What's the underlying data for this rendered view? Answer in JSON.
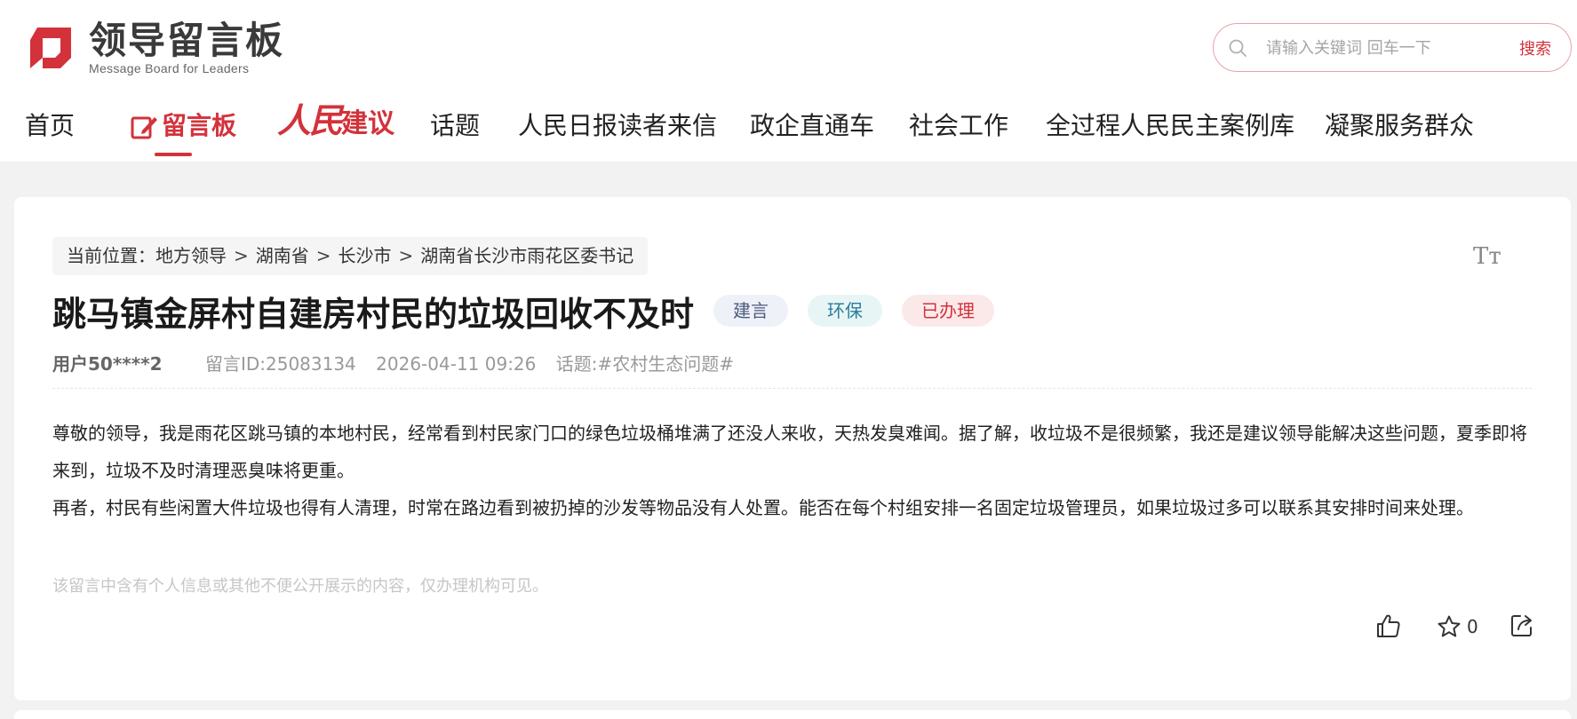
{
  "header": {
    "logo": {
      "title": "领导留言板",
      "subtitle": "Message Board for Leaders",
      "brand_color": "#d3323b"
    },
    "search": {
      "placeholder": "请输入关键词 回车一下",
      "button_label": "搜索",
      "icon": "search-icon"
    },
    "nav": {
      "home": "首页",
      "message_board": "留言板",
      "renmin": "人民",
      "jianyi": "建议",
      "topics": "话题",
      "readers_letters": "人民日报读者来信",
      "gov_enterprise": "政企直通车",
      "social_work": "社会工作",
      "democracy_cases": "全过程人民民主案例库",
      "serve_people": "凝聚服务群众",
      "active_item": "留言板"
    }
  },
  "breadcrumb": {
    "prefix": "当前位置：",
    "items": [
      "地方领导",
      "湖南省",
      "长沙市",
      "湖南省长沙市雨花区委书记"
    ],
    "separator": ">"
  },
  "font_size_toggle": "Tт",
  "post": {
    "title": "跳马镇金屏村自建房村民的垃圾回收不及时",
    "tags": {
      "category": "建言",
      "field": "环保",
      "status": "已办理"
    },
    "user": "用户50****2",
    "message_id": "留言ID:25083134",
    "datetime": "2026-04-11 09:26",
    "topic_label": "话题:",
    "topic": "#农村生态问题#",
    "paragraphs": [
      "尊敬的领导，我是雨花区跳马镇的本地村民，经常看到村民家门口的绿色垃圾桶堆满了还没人来收，天热发臭难闻。据了解，收垃圾不是很频繁，我还是建议领导能解决这些问题，夏季即将来到，垃圾不及时清理恶臭味将更重。",
      "再者，村民有些闲置大件垃圾也得有人清理，时常在路边看到被扔掉的沙发等物品没有人处置。能否在每个村组安排一名固定垃圾管理员，如果垃圾过多可以联系其安排时间来处理。"
    ],
    "privacy_notice": "该留言中含有个人信息或其他不便公开展示的内容，仅办理机构可见。",
    "actions": {
      "like_icon": "thumbs-up-icon",
      "favorite_icon": "star-icon",
      "favorite_count": "0",
      "share_icon": "share-icon"
    }
  },
  "colors": {
    "accent": "#d3323b",
    "page_bg": "#f2f2f3",
    "card_bg": "#ffffff"
  }
}
